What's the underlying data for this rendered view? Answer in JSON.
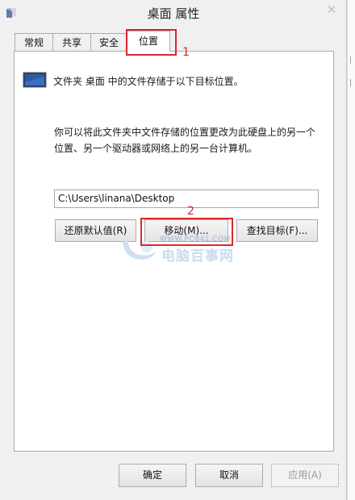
{
  "window": {
    "title": "桌面 属性",
    "close_glyph": "✕"
  },
  "tabs": [
    {
      "label": "常规"
    },
    {
      "label": "共享"
    },
    {
      "label": "安全"
    },
    {
      "label": "位置"
    }
  ],
  "location": {
    "header_text": "文件夹 桌面 中的文件存储于以下目标位置。",
    "description_line1": "你可以将此文件夹中文件存储的位置更改为此硬盘上的另一个",
    "description_line2": "位置、另一个驱动器或网络上的另一台计算机。",
    "path_value": "C:\\Users\\linana\\Desktop",
    "restore_default_label": "还原默认值(R)",
    "move_label": "移动(M)...",
    "find_target_label": "查找目标(F)..."
  },
  "footer": {
    "ok_label": "确定",
    "cancel_label": "取消",
    "apply_label": "应用(A)"
  },
  "annotations": {
    "marker1": "1",
    "marker2": "2"
  },
  "watermark": {
    "url": "WWW.PC841.COM",
    "text": "电脑百事网"
  },
  "colors": {
    "annotation_red": "#d8262c",
    "panel_bg": "#ffffff",
    "dialog_bg": "#f0f0f0"
  },
  "icons": {
    "app": "folder-properties-icon",
    "header": "desktop-monitor-icon"
  }
}
